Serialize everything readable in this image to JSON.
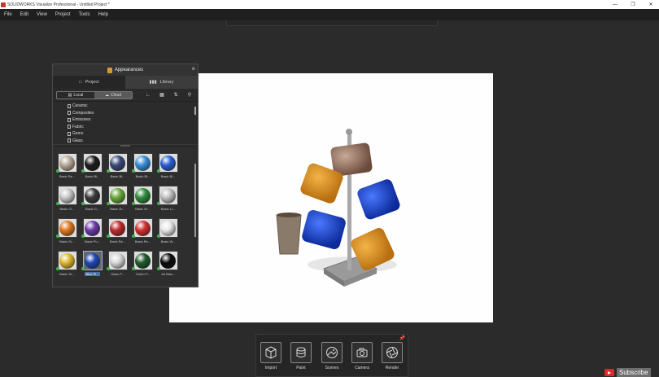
{
  "window": {
    "title": "SOLIDWORKS Visualize Professional - Untitled Project *"
  },
  "menu": [
    "File",
    "Edit",
    "View",
    "Project",
    "Tools",
    "Help"
  ],
  "appearances": {
    "title": "Appearances",
    "tabs": {
      "project": "Project",
      "library": "Library"
    },
    "source": {
      "local": "Local",
      "cloud": "Cloud"
    },
    "tree": [
      "Ceramic",
      "Composites",
      "Emissives",
      "Fabric",
      "Gems",
      "Glass"
    ],
    "materials": [
      {
        "label": "Basic Re...",
        "color": "#b8aa98"
      },
      {
        "label": "Basic Bl...",
        "color": "#1b1b1b"
      },
      {
        "label": "Basic Bl...",
        "color": "#3a4a7a"
      },
      {
        "label": "Basic Bl...",
        "color": "#3a8fd6"
      },
      {
        "label": "Basic Bl...",
        "color": "#2b5fd0"
      },
      {
        "label": "Basic Cl...",
        "color": "#c8c8c8"
      },
      {
        "label": "Basic D...",
        "color": "#3a3a3a"
      },
      {
        "label": "Basic Gr...",
        "color": "#6aa83a"
      },
      {
        "label": "Basic Gr...",
        "color": "#2f8a3a"
      },
      {
        "label": "Basic Li...",
        "color": "#c0c0c0"
      },
      {
        "label": "Basic Or...",
        "color": "#e07820"
      },
      {
        "label": "Basic Pu...",
        "color": "#6a3aa8"
      },
      {
        "label": "Basic Re...",
        "color": "#c02a2a"
      },
      {
        "label": "Basic Re...",
        "color": "#d03030"
      },
      {
        "label": "Basic W...",
        "color": "#e8e8e8"
      },
      {
        "label": "Basic Ye...",
        "color": "#e0b830"
      },
      {
        "label": "Blue Pl...",
        "color": "#1f48b8"
      },
      {
        "label": "Glass P...",
        "color": "#d8d8d8"
      },
      {
        "label": "Green P...",
        "color": "#1f5a2a"
      },
      {
        "label": "Jet Blac...",
        "color": "#0a0a0a"
      }
    ]
  },
  "bottom_toolbar": [
    "Import",
    "Paint",
    "Scenes",
    "Camera",
    "Render"
  ],
  "subscribe": "Subscribe"
}
